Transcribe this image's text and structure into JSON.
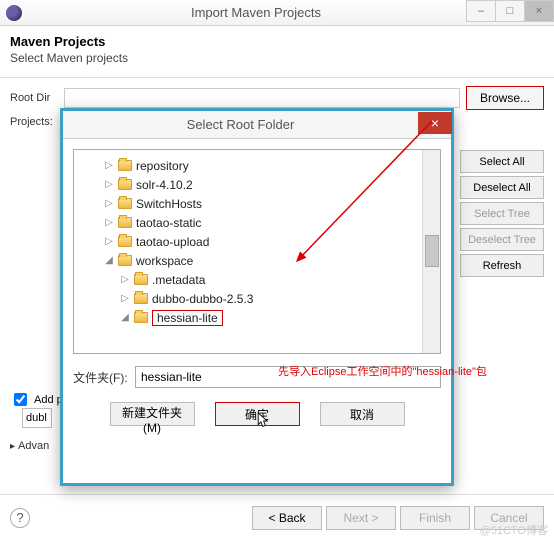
{
  "window": {
    "title": "Import Maven Projects",
    "min_label": "–",
    "max_label": "□",
    "close_label": "×"
  },
  "header": {
    "title": "Maven Projects",
    "subtitle": "Select Maven projects"
  },
  "form": {
    "root_dir_label": "Root Dir",
    "projects_label": "Projects:",
    "browse_label": "Browse...",
    "root_dir_value": ""
  },
  "side_buttons": {
    "select_all": "Select All",
    "deselect_all": "Deselect All",
    "select_tree": "Select Tree",
    "deselect_tree": "Deselect Tree",
    "refresh": "Refresh"
  },
  "checkbox": {
    "label": "Add p",
    "checked": true
  },
  "dropdown": {
    "value": "dubl"
  },
  "advanced_label": "Advan",
  "footer": {
    "back": "< Back",
    "next": "Next >",
    "finish": "Finish",
    "cancel": "Cancel"
  },
  "modal": {
    "title": "Select Root Folder",
    "close_label": "×",
    "tree": [
      {
        "name": "repository",
        "level": 0,
        "arrow": "▷"
      },
      {
        "name": "solr-4.10.2",
        "level": 0,
        "arrow": "▷"
      },
      {
        "name": "SwitchHosts",
        "level": 0,
        "arrow": "▷"
      },
      {
        "name": "taotao-static",
        "level": 0,
        "arrow": "▷"
      },
      {
        "name": "taotao-upload",
        "level": 0,
        "arrow": "▷"
      },
      {
        "name": "workspace",
        "level": 0,
        "arrow": "◢"
      },
      {
        "name": ".metadata",
        "level": 1,
        "arrow": "▷"
      },
      {
        "name": "dubbo-dubbo-2.5.3",
        "level": 1,
        "arrow": "▷"
      },
      {
        "name": "hessian-lite",
        "level": 1,
        "arrow": "◢",
        "selected": true
      }
    ],
    "field_label": "文件夹(F):",
    "field_value": "hessian-lite",
    "new_folder": "新建文件夹(M)",
    "ok": "确定",
    "cancel": "取消"
  },
  "annotation": "先导入Eclipse工作空间中的\"hessian-lite\"包",
  "watermark": "@51CTO博客"
}
